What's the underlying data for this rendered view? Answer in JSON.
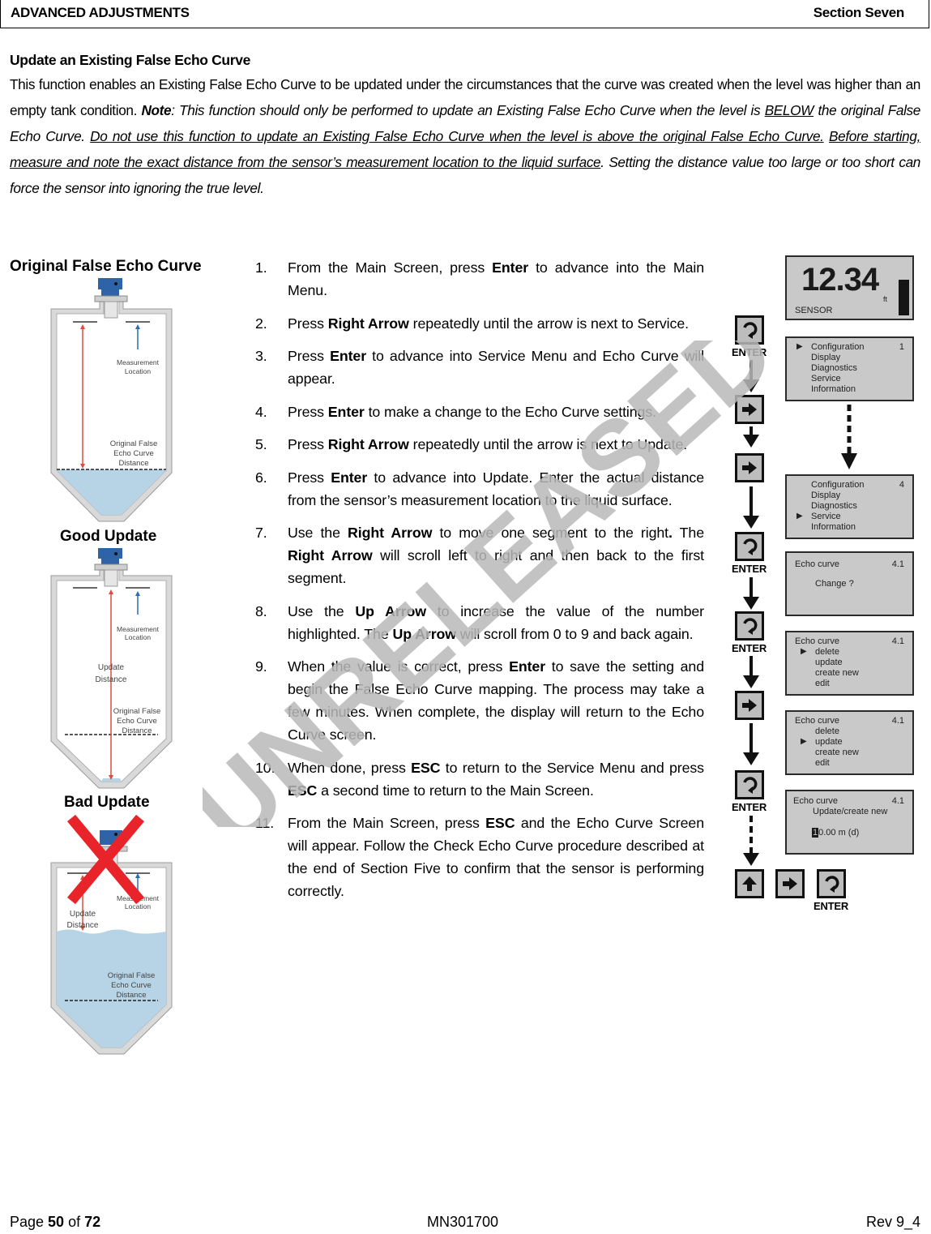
{
  "header": {
    "section_title": "ADVANCED ADJUSTMENTS",
    "section_label": "Section Seven"
  },
  "intro": {
    "heading": "Update an Existing False Echo Curve",
    "p1": "This function enables an Existing False Echo Curve to be updated under the circumstances that the curve was created when the level was higher than an empty tank condition.  ",
    "note_label": "Note",
    "note_a": ": This function should only be performed to update an Existing False Echo Curve when the level is ",
    "note_below": "BELOW",
    "note_b": " the original False Echo Curve.  ",
    "warn_underlined": "Do not use this function to update an Existing False Echo Curve when the level is above the original False Echo Curve.",
    "space": " ",
    "measure_underlined": "Before starting, measure and note the exact distance from the sensor’s measurement location to the liquid surface",
    "period": ".",
    "tail": "  Setting the distance value too large or too short can force the sensor into ignoring the true level."
  },
  "figures": [
    {
      "title": "Original False Echo Curve",
      "measurement_label_1": "Measurement",
      "measurement_label_2": "Location",
      "ofec_1": "Original False",
      "ofec_2": "Echo Curve",
      "ofec_3": "Distance"
    },
    {
      "title": "Good Update",
      "measurement_label_1": "Measurement",
      "measurement_label_2": "Location",
      "update_1": "Update",
      "update_2": "Distance",
      "ofec_1": "Original False",
      "ofec_2": "Echo Curve",
      "ofec_3": "Distance"
    },
    {
      "title": "Bad Update",
      "measurement_label_1": "Measurement",
      "measurement_label_2": "Location",
      "update_1": "Update",
      "update_2": "Distance",
      "ofec_1": "Original False",
      "ofec_2": "Echo Curve",
      "ofec_3": "Distance"
    }
  ],
  "steps": [
    {
      "num": "1.",
      "parts": [
        "From the Main Screen, press ",
        "Enter",
        " to advance into the Main Menu."
      ]
    },
    {
      "num": "2.",
      "parts": [
        "Press ",
        "Right Arrow",
        " repeatedly until the arrow is next to Service."
      ]
    },
    {
      "num": "3.",
      "parts": [
        "Press ",
        "Enter",
        " to advance into Service Menu and Echo Curve will appear."
      ]
    },
    {
      "num": "4.",
      "parts": [
        "Press ",
        "Enter",
        " to make a change to the Echo Curve settings."
      ]
    },
    {
      "num": "5.",
      "parts": [
        "Press ",
        "Right Arrow",
        " repeatedly until the arrow is next to Update."
      ]
    },
    {
      "num": "6.",
      "parts": [
        "Press ",
        "Enter",
        " to advance into Update.  Enter the actual distance from the sensor’s measurement location to the liquid surface."
      ]
    },
    {
      "num": "7.",
      "parts": [
        "Use the ",
        "Right Arrow",
        " to move one segment to the right",
        ".",
        "  The ",
        "Right Arrow",
        " will scroll left to right and then back to the first segment."
      ]
    },
    {
      "num": "8.",
      "parts": [
        "Use the ",
        "Up Arrow",
        " to increase the value of the number highlighted.  The ",
        "Up Arrow",
        " will scroll from 0 to 9 and back again."
      ]
    },
    {
      "num": "9.",
      "parts": [
        "When the value is correct, press ",
        "Enter",
        " to save the setting and begin the False Echo Curve mapping.  The process may take a few minutes.  When complete, the display will return to the Echo Curve screen."
      ]
    },
    {
      "num": "10.",
      "parts": [
        "When done, press ",
        "ESC",
        " to return to the Service Menu and press ",
        "ESC",
        " a second time to return to the Main Screen."
      ]
    },
    {
      "num": "11.",
      "parts": [
        "From the Main Screen, press ",
        "ESC",
        " and the Echo Curve Screen will appear.  Follow the Check Echo Curve procedure described at the end of Section Five to confirm that the sensor is performing correctly."
      ]
    }
  ],
  "flow": {
    "enter_label": "ENTER",
    "main_screen": {
      "value": "12.34",
      "unit": "ft",
      "label": "SENSOR"
    },
    "menu1": {
      "items": [
        "Configuration",
        "Display",
        "Diagnostics",
        "Service",
        "Information"
      ],
      "selected": 0,
      "index": "1"
    },
    "menu2": {
      "items": [
        "Configuration",
        "Display",
        "Diagnostics",
        "Service",
        "Information"
      ],
      "selected": 3,
      "index": "4"
    },
    "change": {
      "title": "Echo curve",
      "index": "4.1",
      "prompt": "Change ?"
    },
    "echo1": {
      "title": "Echo curve",
      "index": "4.1",
      "items": [
        "delete",
        "update",
        "create new",
        "edit"
      ],
      "selected": 0
    },
    "echo2": {
      "title": "Echo curve",
      "index": "4.1",
      "items": [
        "delete",
        "update",
        "create new",
        "edit"
      ],
      "selected": 1
    },
    "update": {
      "title": "Echo curve",
      "index": "4.1",
      "subtitle": "Update/create new",
      "cursor_digit": "1",
      "value_rest": "0.00 m (d)"
    }
  },
  "watermark": "UNRELEASED",
  "footer": {
    "page_prefix": "Page ",
    "page_num": "50",
    "page_of": " of ",
    "page_total": "72",
    "doc_id": "MN301700",
    "rev": "Rev 9_4"
  }
}
